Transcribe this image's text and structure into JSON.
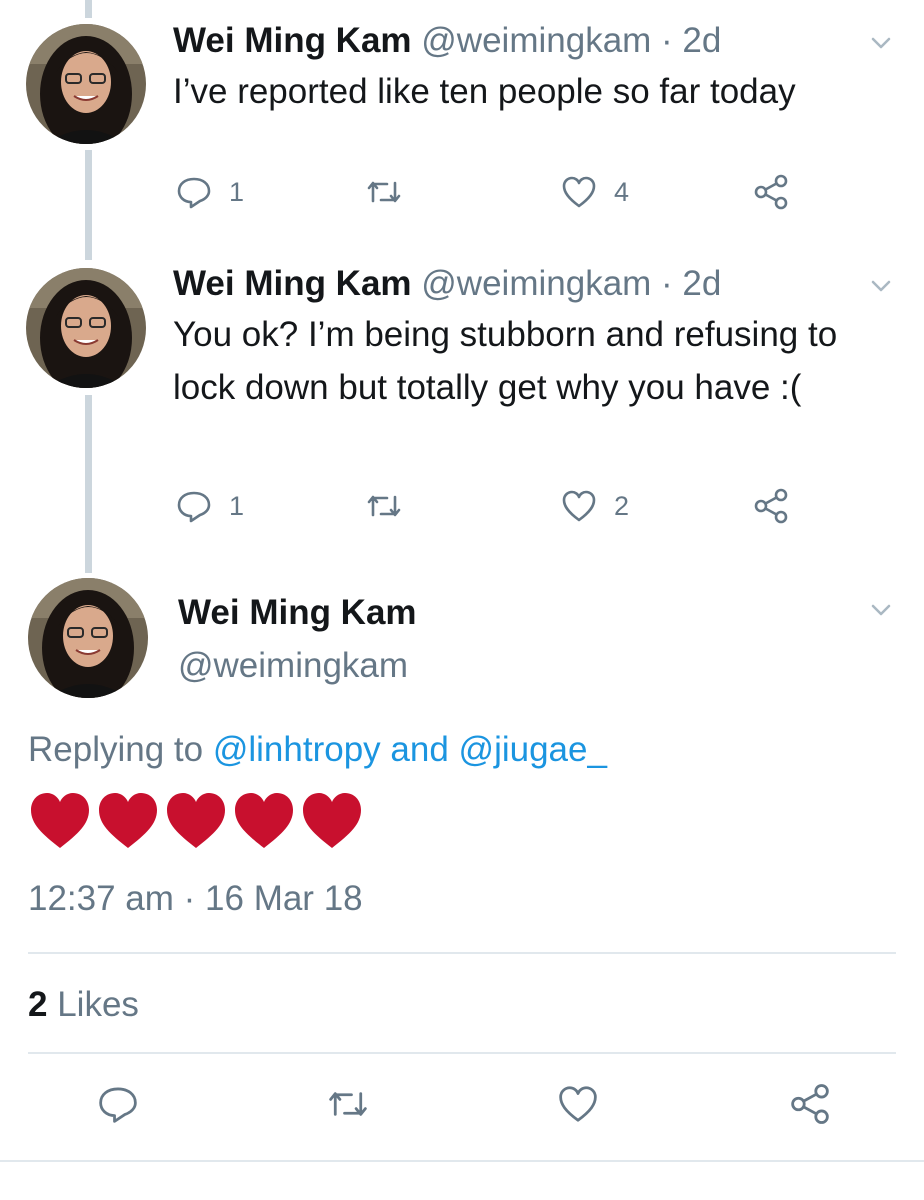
{
  "thread": [
    {
      "name": "Wei Ming Kam",
      "handle": "@weimingkam",
      "time": "· 2d",
      "text": "I’ve reported like ten people so far today",
      "replies": "1",
      "retweets": "",
      "likes": "4"
    },
    {
      "name": "Wei Ming Kam",
      "handle": "@weimingkam",
      "time": "· 2d",
      "text": "You ok? I’m being stubborn and refusing to lock down but totally get why you have :(",
      "replies": "1",
      "retweets": "",
      "likes": "2"
    }
  ],
  "main_tweet": {
    "name": "Wei Ming Kam",
    "handle": "@weimingkam",
    "replying_prefix": "Replying to",
    "reply_user_1": "@linhtropy",
    "reply_and": "and",
    "reply_user_2": "@jiugae_",
    "hearts": [
      "red-heart-icon",
      "red-heart-icon",
      "red-heart-icon",
      "red-heart-icon",
      "red-heart-icon"
    ],
    "timestamp": "12:37 am · 16 Mar 18",
    "likes_count": "2",
    "likes_label": "Likes"
  },
  "icons": {
    "reply": "reply-icon",
    "retweet": "retweet-icon",
    "like": "heart-outline-icon",
    "share": "share-icon",
    "menu": "chevron-down-icon"
  },
  "colors": {
    "text": "#14171a",
    "muted": "#657786",
    "link": "#1b95e0",
    "heart": "#c8102e",
    "thread_line": "#ccd6dd",
    "divider": "#e1e8ed"
  }
}
